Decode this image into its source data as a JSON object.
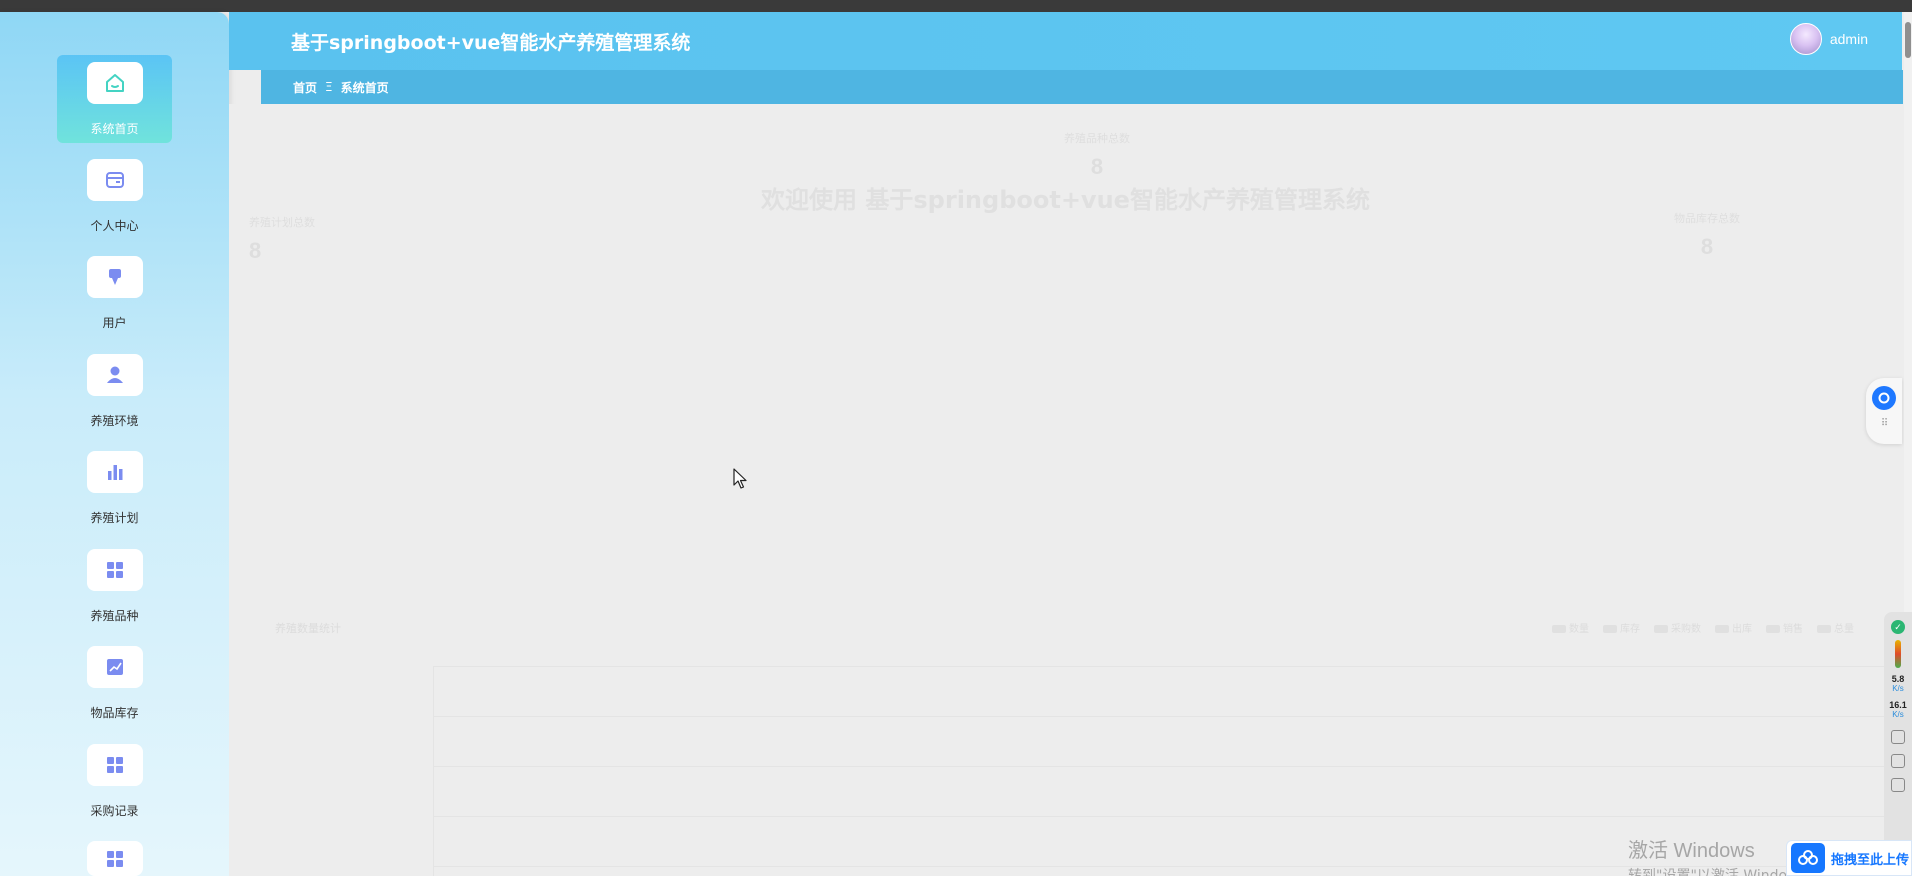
{
  "header": {
    "title": "基于springboot+vue智能水产养殖管理系统",
    "username": "admin"
  },
  "breadcrumb": {
    "home": "首页",
    "separator": "Ξ",
    "current": "系统首页"
  },
  "sidebar": {
    "items": [
      {
        "label": "系统首页",
        "icon": "home-icon",
        "active": true
      },
      {
        "label": "个人中心",
        "icon": "wallet-icon",
        "active": false
      },
      {
        "label": "用户",
        "icon": "pin-icon",
        "active": false
      },
      {
        "label": "养殖环境",
        "icon": "person-icon",
        "active": false
      },
      {
        "label": "养殖计划",
        "icon": "bar-chart-icon",
        "active": false
      },
      {
        "label": "养殖品种",
        "icon": "grid-icon",
        "active": false
      },
      {
        "label": "物品库存",
        "icon": "line-chart-icon",
        "active": false
      },
      {
        "label": "采购记录",
        "icon": "grid-icon",
        "active": false
      },
      {
        "label": "",
        "icon": "grid-icon",
        "active": false
      }
    ]
  },
  "main": {
    "welcome": "欢迎使用 基于springboot+vue智能水产养殖管理系统",
    "stats": [
      {
        "label": "养殖品种总数",
        "value": "8"
      },
      {
        "label": "养殖计划总数",
        "value": "8"
      },
      {
        "label": "物品库存总数",
        "value": "8"
      }
    ],
    "chart_title": "养殖数量统计",
    "legend": [
      "数量",
      "库存",
      "采购数",
      "出库",
      "销售",
      "总量"
    ]
  },
  "system": {
    "activate_title": "激活 Windows",
    "activate_sub": "转到\"设置\"以激活 Windows。",
    "upload_label": "拖拽至此上传",
    "net_up": "5.8",
    "net_up_unit": "K/s",
    "net_down": "16.1",
    "net_down_unit": "K/s"
  },
  "colors": {
    "header": "#5ac2ef",
    "breadcrumb": "#4fb5e2",
    "active_menu_from": "#5bc4f5",
    "active_menu_to": "#70e3dc",
    "icon_active": "#44d3c3",
    "icon_default": "#7b8cf0"
  }
}
